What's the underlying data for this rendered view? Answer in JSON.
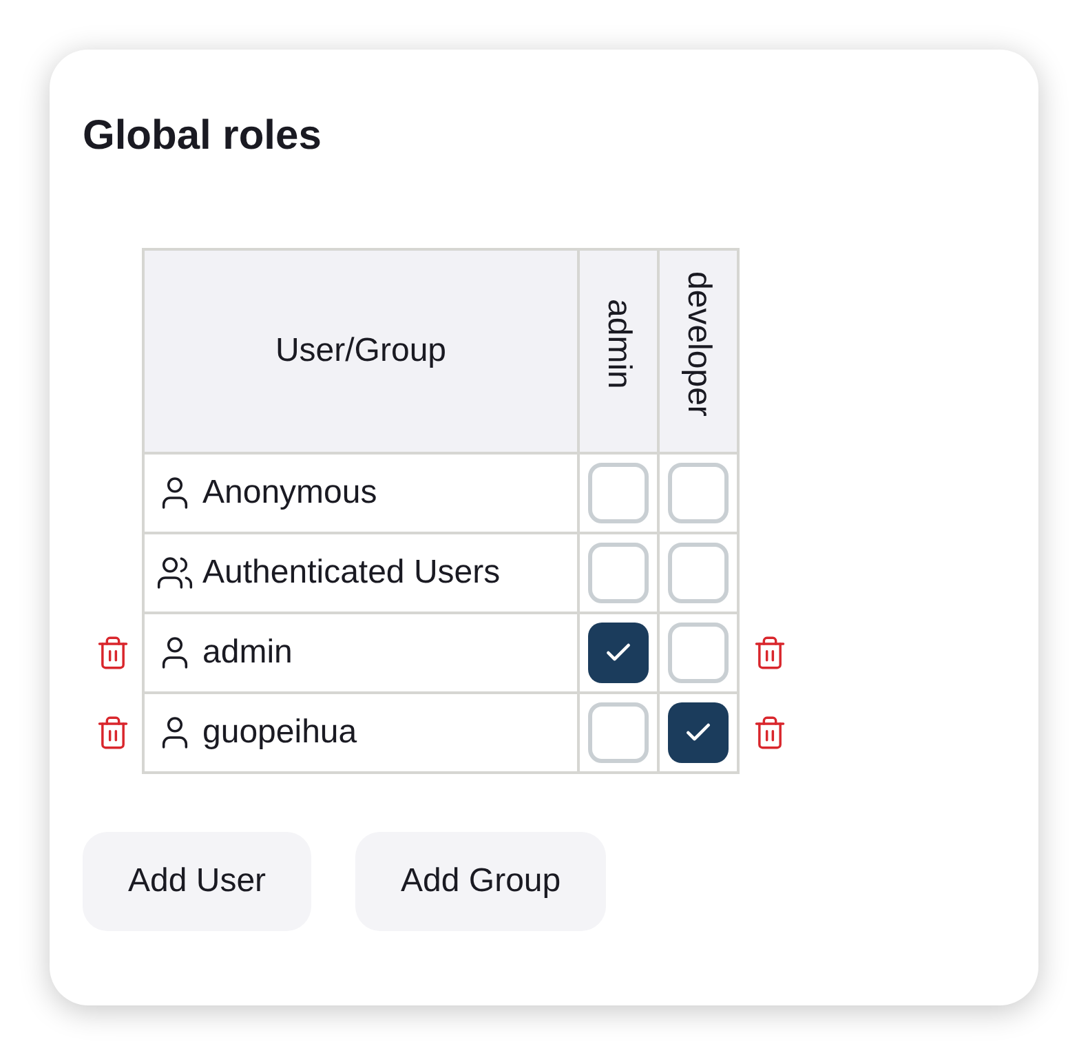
{
  "title": "Global roles",
  "columns": [
    {
      "label": "User/Group"
    },
    {
      "label": "admin"
    },
    {
      "label": "developer"
    }
  ],
  "rows": [
    {
      "kind": "user",
      "name": "Anonymous",
      "deletable": false,
      "roles": [
        {
          "checked": false
        },
        {
          "checked": false
        }
      ]
    },
    {
      "kind": "group",
      "name": "Authenticated Users",
      "deletable": false,
      "roles": [
        {
          "checked": false
        },
        {
          "checked": false
        }
      ]
    },
    {
      "kind": "user",
      "name": "admin",
      "deletable": true,
      "roles": [
        {
          "checked": true
        },
        {
          "checked": false
        }
      ]
    },
    {
      "kind": "user",
      "name": "guopeihua",
      "deletable": true,
      "roles": [
        {
          "checked": false
        },
        {
          "checked": true
        }
      ]
    }
  ],
  "buttons": [
    "Add User",
    "Add Group"
  ]
}
